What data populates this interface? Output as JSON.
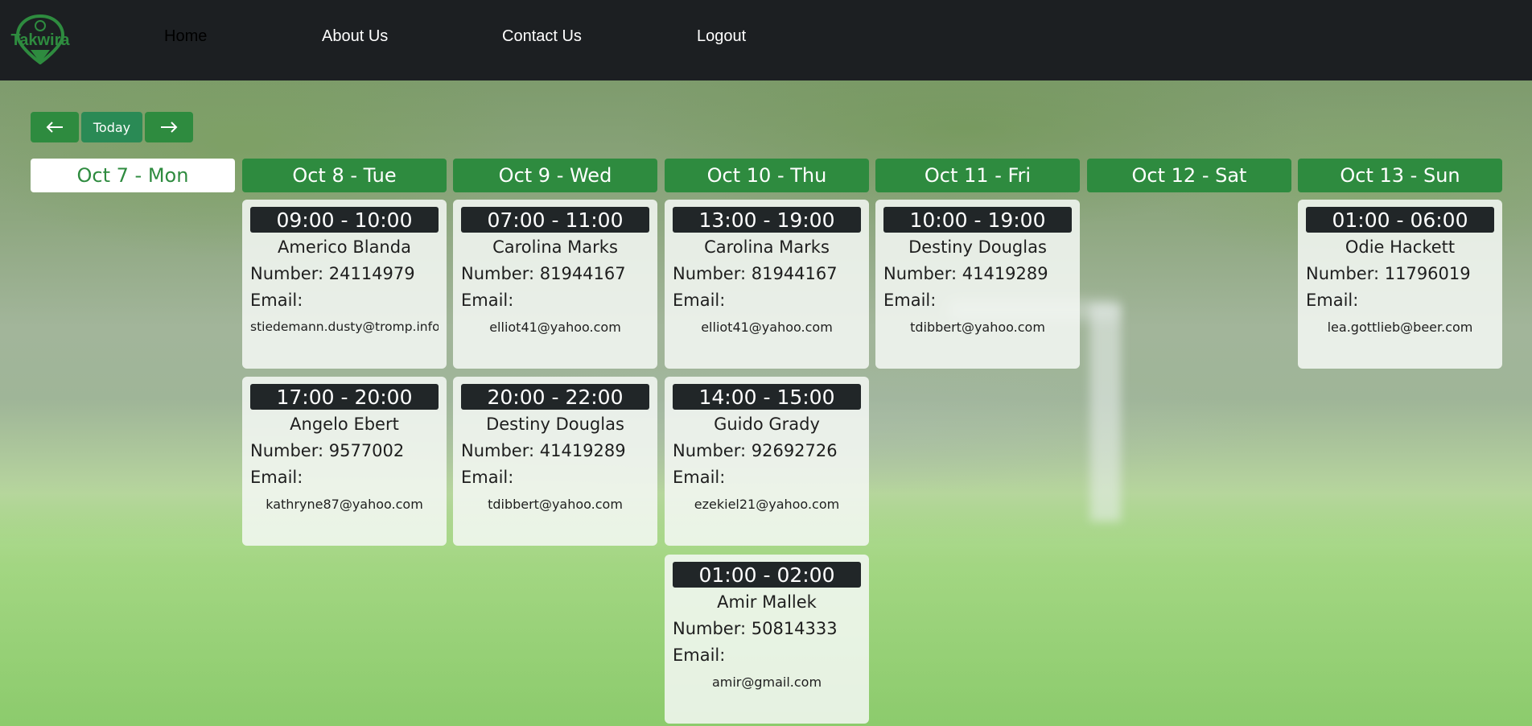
{
  "brand": {
    "name": "Takwira"
  },
  "nav": {
    "items": [
      {
        "label": "Home",
        "active": true
      },
      {
        "label": "About Us",
        "active": false
      },
      {
        "label": "Contact Us",
        "active": false
      },
      {
        "label": "Logout",
        "active": false
      }
    ]
  },
  "controls": {
    "prev_icon": "arrow-left-icon",
    "today_label": "Today",
    "next_icon": "arrow-right-icon"
  },
  "colors": {
    "accent": "#2e8b3f",
    "navbar": "#1c1f22",
    "time_badge": "#212628"
  },
  "days": [
    {
      "label": "Oct 7 - Mon",
      "current": true,
      "bookings": []
    },
    {
      "label": "Oct 8 - Tue",
      "current": false,
      "bookings": [
        {
          "time": "09:00 - 10:00",
          "name": "Americo Blanda",
          "number": "Number: 24114979",
          "email_label": "Email:",
          "email": "stiedemann.dusty@tromp.info"
        },
        {
          "time": "17:00 - 20:00",
          "name": "Angelo Ebert",
          "number": "Number: 9577002",
          "email_label": "Email:",
          "email": "kathryne87@yahoo.com"
        }
      ]
    },
    {
      "label": "Oct 9 - Wed",
      "current": false,
      "bookings": [
        {
          "time": "07:00 - 11:00",
          "name": "Carolina Marks",
          "number": "Number: 81944167",
          "email_label": "Email:",
          "email": "elliot41@yahoo.com"
        },
        {
          "time": "20:00 - 22:00",
          "name": "Destiny Douglas",
          "number": "Number: 41419289",
          "email_label": "Email:",
          "email": "tdibbert@yahoo.com"
        }
      ]
    },
    {
      "label": "Oct 10 - Thu",
      "current": false,
      "bookings": [
        {
          "time": "13:00 - 19:00",
          "name": "Carolina Marks",
          "number": "Number: 81944167",
          "email_label": "Email:",
          "email": "elliot41@yahoo.com"
        },
        {
          "time": "14:00 - 15:00",
          "name": "Guido Grady",
          "number": "Number: 92692726",
          "email_label": "Email:",
          "email": "ezekiel21@yahoo.com"
        },
        {
          "time": "01:00 - 02:00",
          "name": "Amir Mallek",
          "number": "Number: 50814333",
          "email_label": "Email:",
          "email": "amir@gmail.com"
        }
      ]
    },
    {
      "label": "Oct 11 - Fri",
      "current": false,
      "bookings": [
        {
          "time": "10:00 - 19:00",
          "name": "Destiny Douglas",
          "number": "Number: 41419289",
          "email_label": "Email:",
          "email": "tdibbert@yahoo.com"
        }
      ]
    },
    {
      "label": "Oct 12 - Sat",
      "current": false,
      "bookings": []
    },
    {
      "label": "Oct 13 - Sun",
      "current": false,
      "bookings": [
        {
          "time": "01:00 - 06:00",
          "name": "Odie Hackett",
          "number": "Number: 11796019",
          "email_label": "Email:",
          "email": "lea.gottlieb@beer.com"
        }
      ]
    }
  ]
}
